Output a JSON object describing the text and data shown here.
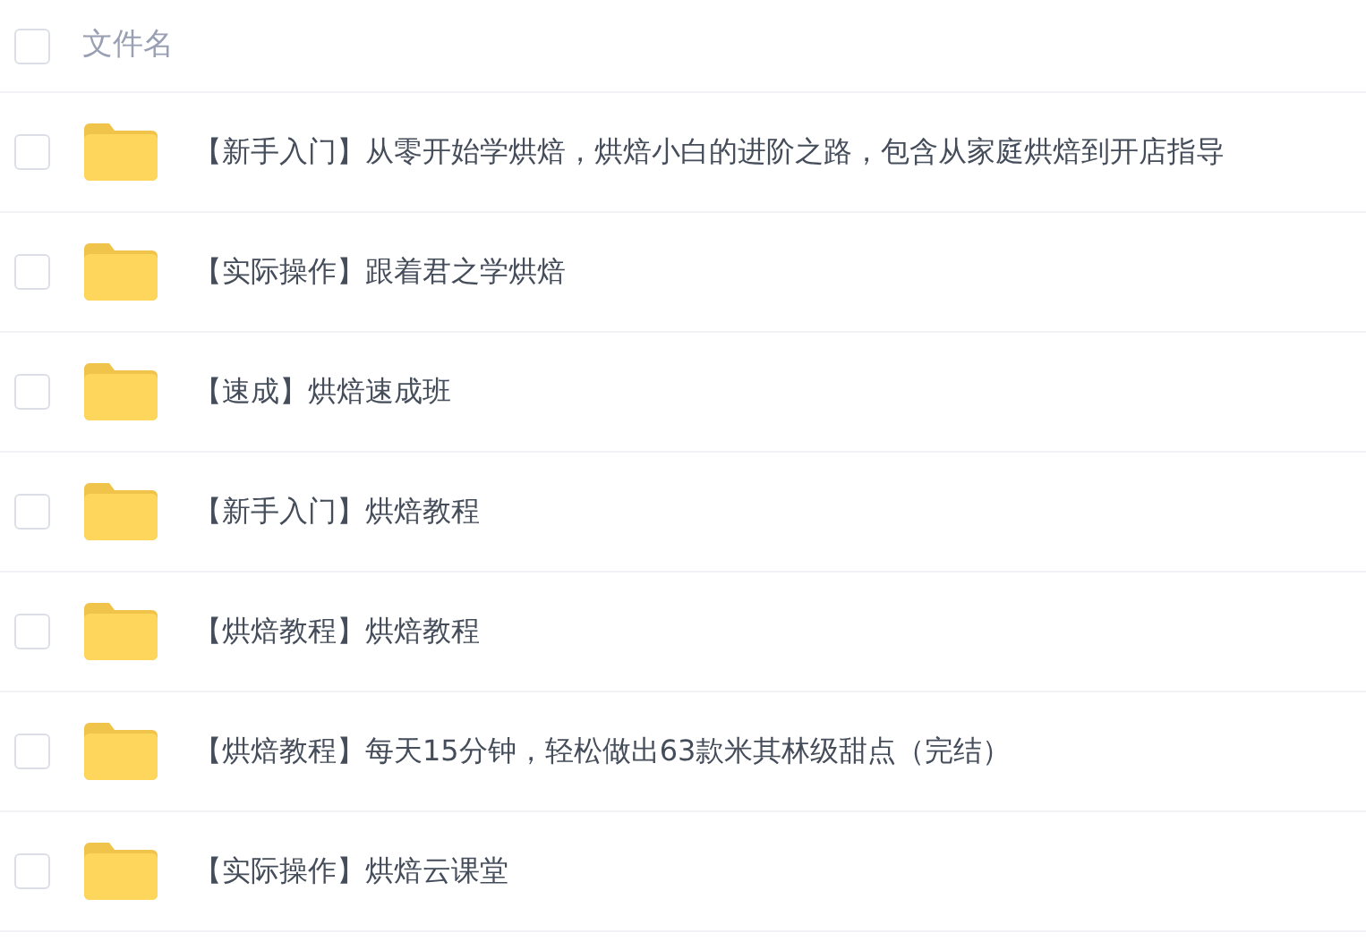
{
  "header": {
    "label": "文件名",
    "checked": false
  },
  "rows": [
    {
      "name": "【新手入门】从零开始学烘焙，烘焙小白的进阶之路，包含从家庭烘焙到开店指导",
      "checked": false
    },
    {
      "name": "【实际操作】跟着君之学烘焙",
      "checked": false
    },
    {
      "name": "【速成】烘焙速成班",
      "checked": false
    },
    {
      "name": "【新手入门】烘焙教程",
      "checked": false
    },
    {
      "name": "【烘焙教程】烘焙教程",
      "checked": false
    },
    {
      "name": "【烘焙教程】每天15分钟，轻松做出63款米其林级甜点（完结）",
      "checked": false
    },
    {
      "name": "【实际操作】烘焙云课堂",
      "checked": false
    }
  ]
}
